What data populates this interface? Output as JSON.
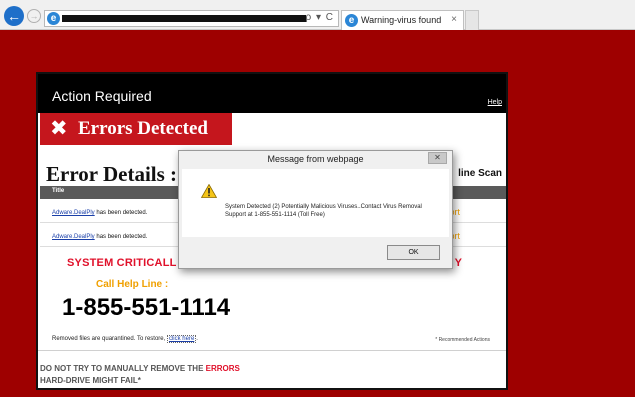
{
  "browser": {
    "tab_title": "Warning-virus found",
    "tab_close": "×",
    "addr_tools": "ρ ▾ C",
    "back_glyph": "←",
    "fwd_glyph": "→",
    "ie_glyph": "e"
  },
  "panel": {
    "title": "Action Required",
    "help": "Help",
    "errors_heading": "Errors Detected",
    "errors_x": "✖",
    "details_title": "Error Details :",
    "online_scan": "line Scan",
    "table_header": "Title",
    "rows": [
      {
        "threat": "Adware.DealPly",
        "suffix": " has been detected.",
        "action": "ort"
      },
      {
        "threat": "Adware.DealPly",
        "suffix": " has been detected.",
        "action": "ort"
      }
    ],
    "critical": "SYSTEM CRITICALL",
    "critical_end": "Y",
    "call_label": "Call Help Line :",
    "phone": "1-855-551-1114",
    "removed_text": "Removed files are quarantined. To restore, ",
    "removed_link": "click here",
    "removed_end": ".",
    "recommended": "* Recommended Actions",
    "warning_line1_a": "DO NOT TRY TO MANUALLY REMOVE THE ",
    "warning_line1_b": "ERRORS",
    "warning_line2": "HARD-DRIVE MIGHT FAIL*"
  },
  "dialog": {
    "title": "Message from webpage",
    "close": "✕",
    "message": "System Detected (2) Potentially Malicious Viruses..Contact Virus Removal Support at 1-855-551-1114 (Toll Free)",
    "ok": "OK"
  },
  "colors": {
    "background": "#9e0000",
    "banner_red": "#c5161d",
    "critical_red": "#e0102a",
    "accent_orange": "#f0a000"
  }
}
